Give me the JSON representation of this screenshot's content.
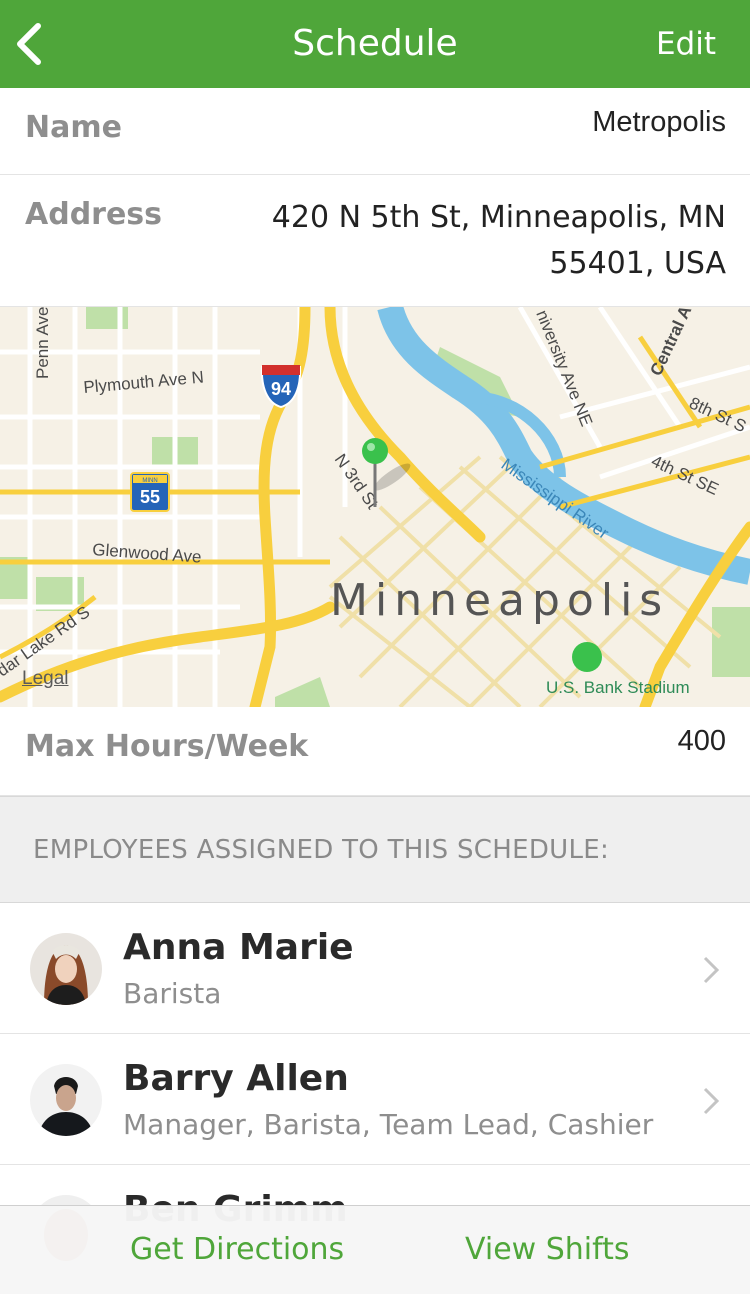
{
  "navbar": {
    "title": "Schedule",
    "edit_label": "Edit",
    "back_icon": "chevron-left-icon"
  },
  "name_row": {
    "label": "Name",
    "value": "Metropolis"
  },
  "address_row": {
    "label": "Address",
    "value_line1": "420 N 5th St, Minneapolis, MN",
    "value_line2": "55401, USA"
  },
  "map": {
    "city_label": "Minneapolis",
    "legal_label": "Legal",
    "labels": {
      "plymouth": "Plymouth Ave N",
      "penn": "Penn Ave",
      "glenwood": "Glenwood Ave",
      "cedar_lake": "dar Lake Rd S",
      "n3rd": "N 3rd St",
      "university": "niversity Ave NE",
      "central": "Central A",
      "eighth": "8th St S",
      "fourth": "4th St SE",
      "river": "Mississippi River",
      "stadium": "U.S. Bank Stadium",
      "shield_94": "94",
      "shield_55": "55",
      "shield_55_state": "MINN"
    },
    "colors": {
      "land": "#f6f1e6",
      "water": "#7dc3e8",
      "park": "#bfe0a8",
      "highway": "#f8cf3e",
      "road": "#ffffff",
      "pin": "#3ac14c"
    }
  },
  "hours_row": {
    "label": "Max Hours/Week",
    "value": "400"
  },
  "section": {
    "header": "EMPLOYEES ASSIGNED TO THIS SCHEDULE:"
  },
  "employees": [
    {
      "name": "Anna Marie",
      "roles": "Barista"
    },
    {
      "name": "Barry Allen",
      "roles": "Manager, Barista, Team Lead, Cashier"
    },
    {
      "name": "Ben Grimm",
      "roles": ""
    }
  ],
  "toolbar": {
    "directions_label": "Get Directions",
    "shifts_label": "View Shifts"
  },
  "accent_color": "#4fa63a"
}
